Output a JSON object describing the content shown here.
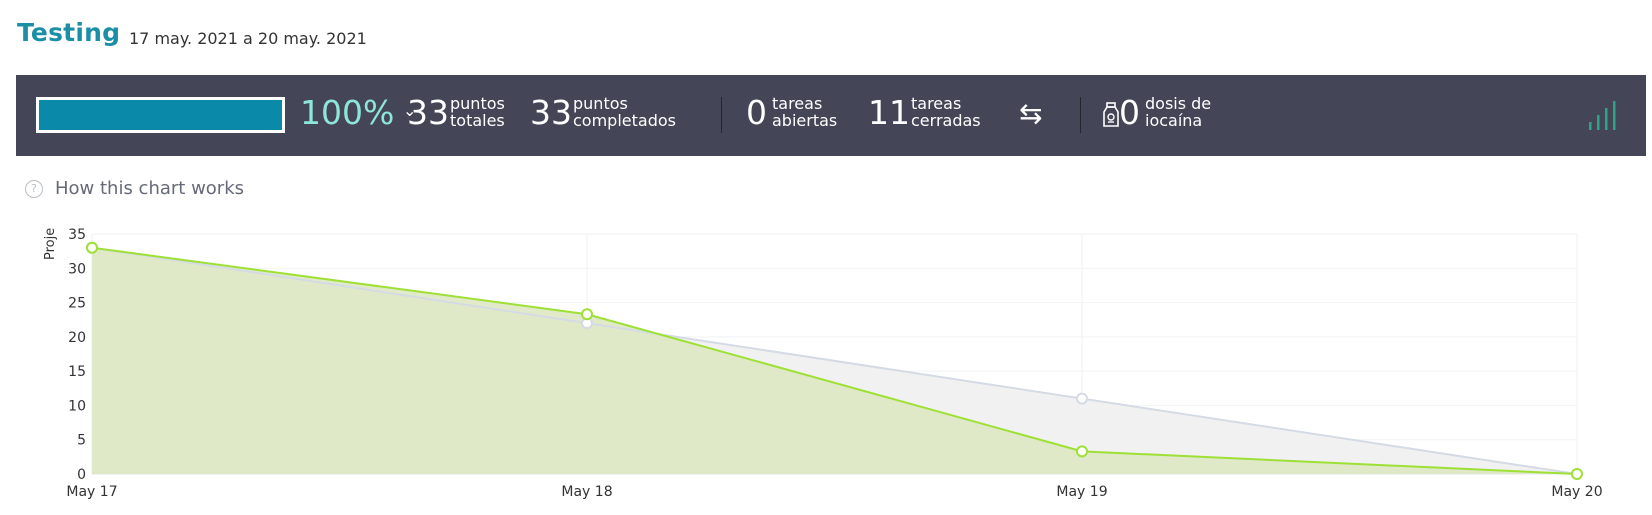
{
  "header": {
    "title": "Testing",
    "date_range": "17 may. 2021 a 20 may. 2021"
  },
  "stats": {
    "progress_fraction": 1.0,
    "progress_percent": "100%",
    "total_points": {
      "value": "33",
      "label_line1": "puntos",
      "label_line2": "totales"
    },
    "completed_points": {
      "value": "33",
      "label_line1": "puntos",
      "label_line2": "completados"
    },
    "open_tasks": {
      "value": "0",
      "label_line1": "tareas",
      "label_line2": "abiertas"
    },
    "closed_tasks": {
      "value": "11",
      "label_line1": "tareas",
      "label_line2": "cerradas"
    },
    "iocaine": {
      "value": "0",
      "label_line1": "dosis de",
      "label_line2": "iocaína"
    }
  },
  "icons": [
    "chevron-down-icon",
    "swap-arrows-icon",
    "potion-jar-icon",
    "signal-bars-icon",
    "help-circle-icon"
  ],
  "help": {
    "icon_glyph": "?",
    "text": "How this chart works"
  },
  "colors": {
    "title": "#1b8fa6",
    "bar_bg": "#444556",
    "progress": "#0a8aa8",
    "percent": "#8ee6d8",
    "real_line": "#9ee035",
    "real_fill": "#dde8c3",
    "ideal_line": "#d4dbe5",
    "ideal_fill": "#f1f1f1"
  },
  "chart_data": {
    "type": "area",
    "ylabel": "Proje",
    "categories": [
      "May 17",
      "May 18",
      "May 19",
      "May 20"
    ],
    "yticks": [
      "0",
      "5",
      "10",
      "15",
      "20",
      "25",
      "30",
      "35"
    ],
    "ylim": [
      0,
      35
    ],
    "grid": true,
    "series": [
      {
        "values": [
          33,
          22,
          11,
          0
        ],
        "color": "#d4dbe5"
      },
      {
        "values": [
          33,
          23.3,
          3.3,
          0
        ],
        "color": "#9ee035"
      }
    ]
  }
}
